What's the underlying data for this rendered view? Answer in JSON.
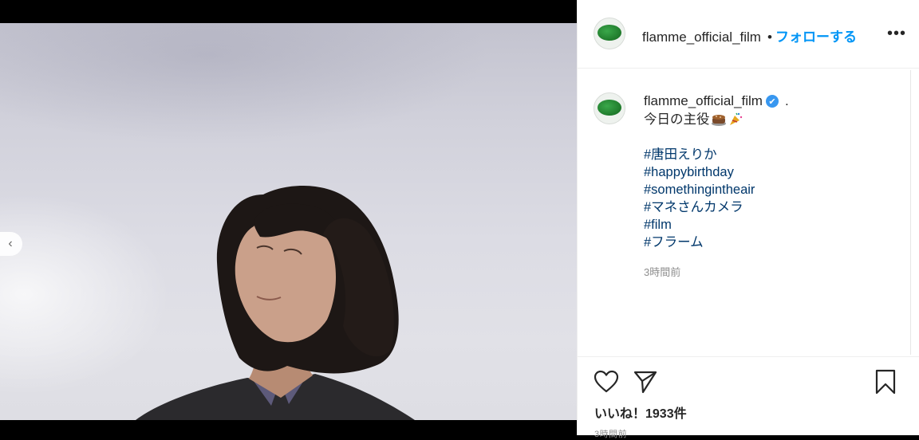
{
  "post": {
    "username": "flamme_official_film",
    "header_username": "flamme_official_film",
    "separator": "•",
    "follow_label": "フォローする",
    "more_label": "•••",
    "nav_prev_label": "‹",
    "carousel": {
      "count": 2,
      "active_index": 1
    }
  },
  "caption": {
    "username": "flamme_official_film",
    "verified_mark": "✔",
    "trailing": ".",
    "first_line": "今日の主役",
    "emojis": [
      "cake-emoji",
      "party-popper-emoji"
    ],
    "hashtags": [
      "#唐田えりか",
      "#happybirthday",
      "#somethingintheair",
      "#マネさんカメラ",
      "#film",
      "#フラーム"
    ],
    "time": "3時間前"
  },
  "actions": {
    "icons": [
      "heart-icon",
      "share-icon",
      "bookmark-icon"
    ],
    "likes": "いいね！1933件",
    "time": "3時間前"
  },
  "colors": {
    "accent": "#0095f6",
    "hashtag": "#00376b",
    "verified": "#3897f0",
    "text": "#262626",
    "muted": "#8e8e8e"
  }
}
